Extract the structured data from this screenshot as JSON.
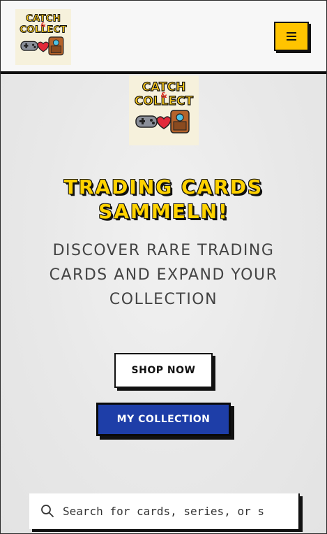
{
  "header": {
    "logo_alt": "Catch & Collect",
    "menu_icon": "hamburger-icon"
  },
  "hero": {
    "logo_alt": "Catch & Collect",
    "title_line1": "Trading Cards",
    "title_line2": "Sammeln!",
    "subtitle_line1": "Discover rare trading",
    "subtitle_line2": "cards and expand your",
    "subtitle_line3": "collection",
    "shop_button_label": "Shop Now",
    "collection_button_label": "My Collection"
  },
  "search": {
    "placeholder": "Search for cards, series, or s",
    "icon": "search-icon"
  },
  "colors": {
    "accent_yellow": "#ffc400",
    "title_yellow": "#ffd200",
    "button_blue": "#1e3ea8",
    "border_dark": "#111111"
  }
}
